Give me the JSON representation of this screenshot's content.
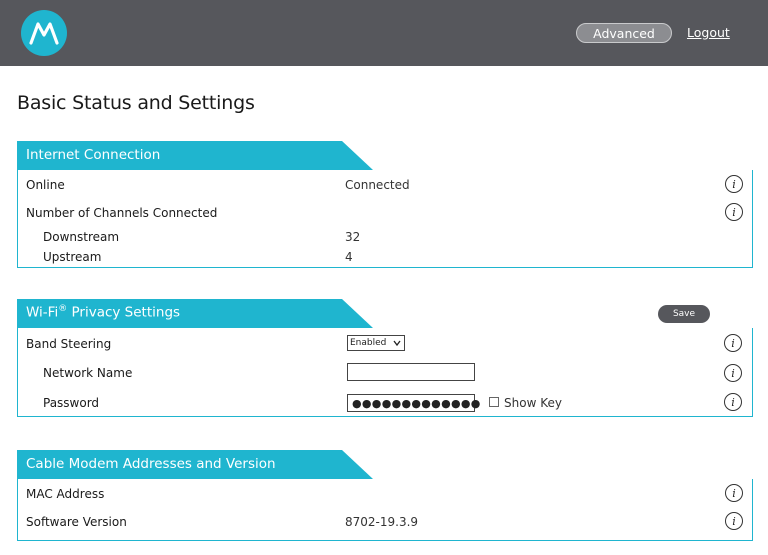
{
  "header": {
    "advanced_label": "Advanced",
    "logout_label": "Logout"
  },
  "page": {
    "title": "Basic Status and Settings"
  },
  "internet": {
    "title": "Internet Connection",
    "online_label": "Online",
    "online_value": "Connected",
    "channels_label": "Number of Channels Connected",
    "downstream_label": "Downstream",
    "downstream_value": "32",
    "upstream_label": "Upstream",
    "upstream_value": "4"
  },
  "wifi": {
    "title": "Wi-Fi",
    "title_sup": "®",
    "title_rest": " Privacy Settings",
    "save_label": "Save",
    "band_steering_label": "Band Steering",
    "band_steering_value": "Enabled",
    "network_name_label": "Network Name",
    "network_name_value": "",
    "password_label": "Password",
    "password_value": "●●●●●●●●●●●●●",
    "show_key_label": "Show Key"
  },
  "cable": {
    "title": "Cable Modem Addresses and Version",
    "mac_label": "MAC Address",
    "software_label": "Software Version",
    "software_value": "8702-19.3.9"
  },
  "colors": {
    "accent": "#1fb5cf",
    "topbar": "#56575c"
  },
  "icons": {
    "logo": "motorola-logo-icon",
    "info": "info-icon"
  }
}
